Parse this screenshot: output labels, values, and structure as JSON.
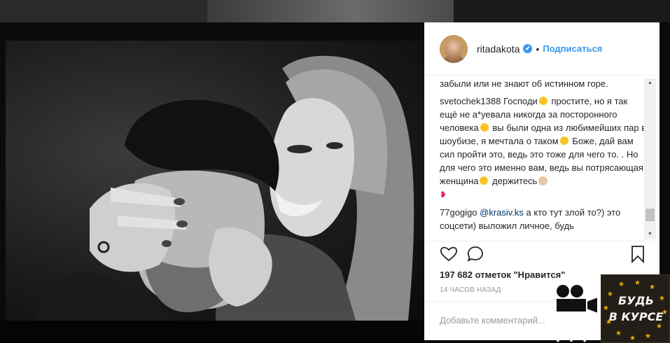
{
  "post": {
    "username": "ritadakota",
    "separator": "•",
    "follow_label": "Подписаться",
    "verified_mark": "✔"
  },
  "comments": [
    {
      "user": "",
      "text": "забыли или не знают об истинном горе."
    },
    {
      "user": "svetochek1388",
      "text_1": "Господи",
      "text_2": "простите, но я так ещё не а*уевала никогда за посторонного человека",
      "text_3": "вы были одна из любимейших пар в шоубизе, я мечтала о таком",
      "text_4": "Боже, дай вам сил пройти это, ведь это тоже для чего то. . Но для чего это именно вам, ведь вы потрясающая женщина",
      "text_5": "держитесь"
    },
    {
      "user": "77gogigo",
      "mention": "@krasiv.ks",
      "text": "а кто тут злой то?) это соцсети) выложил личное, будь"
    }
  ],
  "likes_text": "197 682 отметок \"Нравится\"",
  "timestamp": "14 ЧАСОВ НАЗАД",
  "comment_placeholder": "Добавьте комментарий...",
  "watermark": {
    "line1": "БУДЬ",
    "line2": "В КУРСЕ"
  },
  "colors": {
    "accent": "#3897f0",
    "panel_bg": "#ffffff",
    "text": "#262626",
    "muted": "#999999"
  }
}
